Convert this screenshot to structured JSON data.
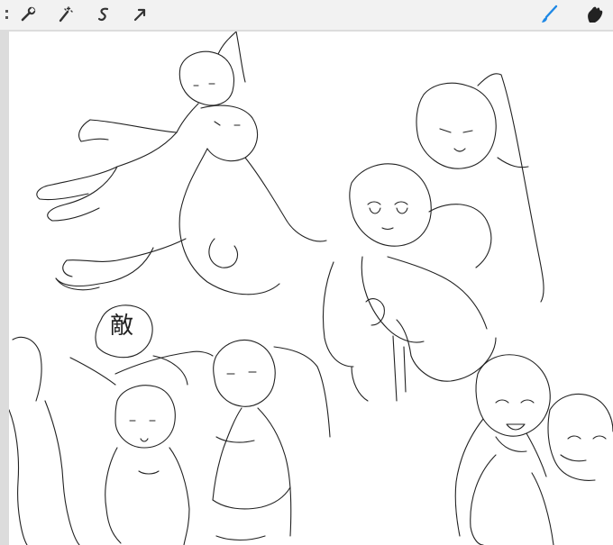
{
  "toolbar": {
    "left_tools": [
      {
        "icon": "gallery-edge-icon"
      },
      {
        "icon": "wrench-icon"
      },
      {
        "icon": "magic-wand-icon"
      },
      {
        "icon": "selection-icon"
      },
      {
        "icon": "transform-arrow-icon"
      }
    ],
    "right_tools": [
      {
        "icon": "brush-icon",
        "active": true,
        "color": "#1e88e5"
      },
      {
        "icon": "smudge-icon"
      }
    ]
  },
  "canvas": {
    "annotation_text": "敵"
  },
  "colors": {
    "toolbar_bg": "#f2f2f2",
    "workspace_bg": "#dcdcdc",
    "paper": "#ffffff",
    "brush_active": "#1e88e5",
    "ink": "#222222"
  }
}
